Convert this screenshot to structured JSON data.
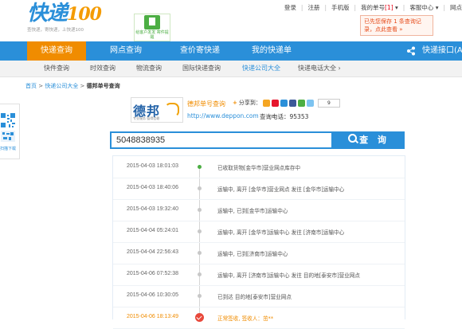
{
  "top_bar": {
    "login": "登录",
    "register": "注册",
    "mobile": "手机版",
    "my_waybill": "我的单号",
    "my_waybill_count": "[1]",
    "service_center": "客服中心",
    "more": "网点"
  },
  "logo": {
    "brand": "快递",
    "brand_suffix": "100",
    "slogan": "查快递，寄快递，上快递100"
  },
  "promo": {
    "text": "给客户发发 寄件提醒"
  },
  "notice": {
    "text": "已先您保存 1 条查询记录，点此查看 »"
  },
  "nav": {
    "items": [
      "快递查询",
      "网点查询",
      "查价寄快递",
      "我的快递单"
    ],
    "right": "快递接口(A"
  },
  "subnav": {
    "items": [
      "快件查询",
      "时效查询",
      "物流查询",
      "国际快递查询",
      "快递公司大全",
      "快递电话大全"
    ]
  },
  "breadcrumb": {
    "home": "首页",
    "company_list": "快递公司大全",
    "current": "德邦单号查询"
  },
  "qr": {
    "caption": "扫描下载"
  },
  "company": {
    "logo_text": "德邦",
    "logo_sub": "专业服务 值得信赖",
    "title": "德邦单号查询",
    "share_label": "分享到：",
    "share_count": "9",
    "url": "http://www.deppon.com",
    "tel": "查询电话：95353"
  },
  "search": {
    "value": "5048838935",
    "button": "查 询"
  },
  "tracking": [
    {
      "time": "2015-04-03 18:01:03",
      "text": "已收取货物[金华市]营业网点库存中"
    },
    {
      "time": "2015-04-03 18:40:06",
      "text": "运输中, 离开 [金华市]营业网点 发往 [金华市]运输中心"
    },
    {
      "time": "2015-04-03 19:32:40",
      "text": "运输中, 已到[金华市]运输中心"
    },
    {
      "time": "2015-04-04 05:24:01",
      "text": "运输中, 离开 [金华市]运输中心 发往 [济南市]运输中心"
    },
    {
      "time": "2015-04-04 22:56:43",
      "text": "运输中, 已到[济南市]运输中心"
    },
    {
      "time": "2015-04-06 07:52:38",
      "text": "运输中, 离开 [济南市]运输中心 发往 目的地[泰安市]营业网点"
    },
    {
      "time": "2015-04-06 10:30:05",
      "text": "已到达 目的地[泰安市]营业网点"
    },
    {
      "time": "2015-04-06 18:13:49",
      "text": "正常签收, 签收人：茁**"
    }
  ],
  "colors": {
    "primary_blue": "#2a8fd9",
    "orange": "#f08c00",
    "green": "#4cae43",
    "red": "#e8483b"
  }
}
